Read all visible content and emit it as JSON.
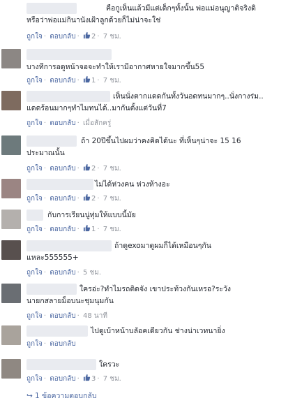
{
  "comments": [
    {
      "text_lines": [
        "คือกูเห็นแล้วมีแต่เด็กๆทั้งนั้น พ่อแม่อนุญาติจริงดิ",
        "หรือว่าพ่อแม่กินานังเฝ้าลูกด้วยก็ไม่น่าจะใช่"
      ],
      "like": "ถูกใจ",
      "reply": "ตอบกลับ",
      "likes": "2",
      "time": "7 ชม.",
      "avatar_color": "#ffffff"
    },
    {
      "text_lines": [
        "บางทีการอดูหน้าจอจะทำให้เรามีอากาศหายใจมากขึ้น55"
      ],
      "like": "ถูกใจ",
      "reply": "ตอบกลับ",
      "likes": "1",
      "time": "7 ชม.",
      "avatar_color": "#8c8784"
    },
    {
      "text_lines": [
        "เห็นนั่งตากแดดกันทั้งวันอดทนมากๆ..นั่งกางร่ม..",
        "แดดร้อนมากๆทำไมทนได้..มากันตั้งแต่วันที่7"
      ],
      "like": "ถูกใจ",
      "reply": "ตอบกลับ",
      "likes": "",
      "time": "เมื่อสักครู่",
      "avatar_color": "#7e6b5f"
    },
    {
      "text_lines": [
        "ถ้า 20ปีขึ้นไปผมว่าคงคิดได้นะ ที่เห็นๆน่าจะ 15 16",
        "ประมาณนั้น"
      ],
      "like": "ถูกใจ",
      "reply": "ตอบกลับ",
      "likes": "2",
      "time": "7 ชม.",
      "avatar_color": "#6d7a7c"
    },
    {
      "text_lines": [
        "ไม่ได้ห่วงคน ห่วงห้างอะ"
      ],
      "like": "ถูกใจ",
      "reply": "ตอบกลับ",
      "likes": "2",
      "time": "7 ชม.",
      "avatar_color": "#9b8583"
    },
    {
      "text_lines": [
        "กับการเรียนนู่ทุ่มให้แบบนี้มัย"
      ],
      "like": "ถูกใจ",
      "reply": "ตอบกลับ",
      "likes": "1",
      "time": "7 ชม.",
      "avatar_color": "#b4b0ad"
    },
    {
      "text_lines": [
        "ถ้าดูexoมาดูผมก็ได้เหมือนๆกัน",
        "แหละ555555+"
      ],
      "like": "ถูกใจ",
      "reply": "ตอบกลับ",
      "likes": "",
      "time": "5 ชม.",
      "avatar_color": "#58504e"
    },
    {
      "text_lines": [
        "ใครอ่ะ?ทำไมรถติดจัง เขาประท้วงกันเหรอ?ระวัง",
        "นายกสลายม็อบนะชุมนุมกัน"
      ],
      "like": "ถูกใจ",
      "reply": "ตอบกลับ",
      "likes": "",
      "time": "48 นาที",
      "avatar_color": "#6a6e73"
    },
    {
      "text_lines": [
        "ไปดูเบ้าหน้าบลัอคเดียวกัน ช่างน่าเวทนายิ่ง"
      ],
      "like": "ถูกใจ",
      "reply": "ตอบกลับ",
      "likes": "",
      "time": "",
      "avatar_color": "#a9a39c"
    },
    {
      "text_lines": [
        "ใครวะ"
      ],
      "like": "ถูกใจ",
      "reply": "ตอบกลับ",
      "likes": "3",
      "time": "7 ชม.",
      "avatar_color": "#8f8882"
    }
  ],
  "more_replies": "1 ข้อความตอบกลับ",
  "colors": {
    "link": "#4b67a1",
    "meta": "#90949c",
    "text": "#1d2129",
    "like_icon": "#4b67a1"
  }
}
